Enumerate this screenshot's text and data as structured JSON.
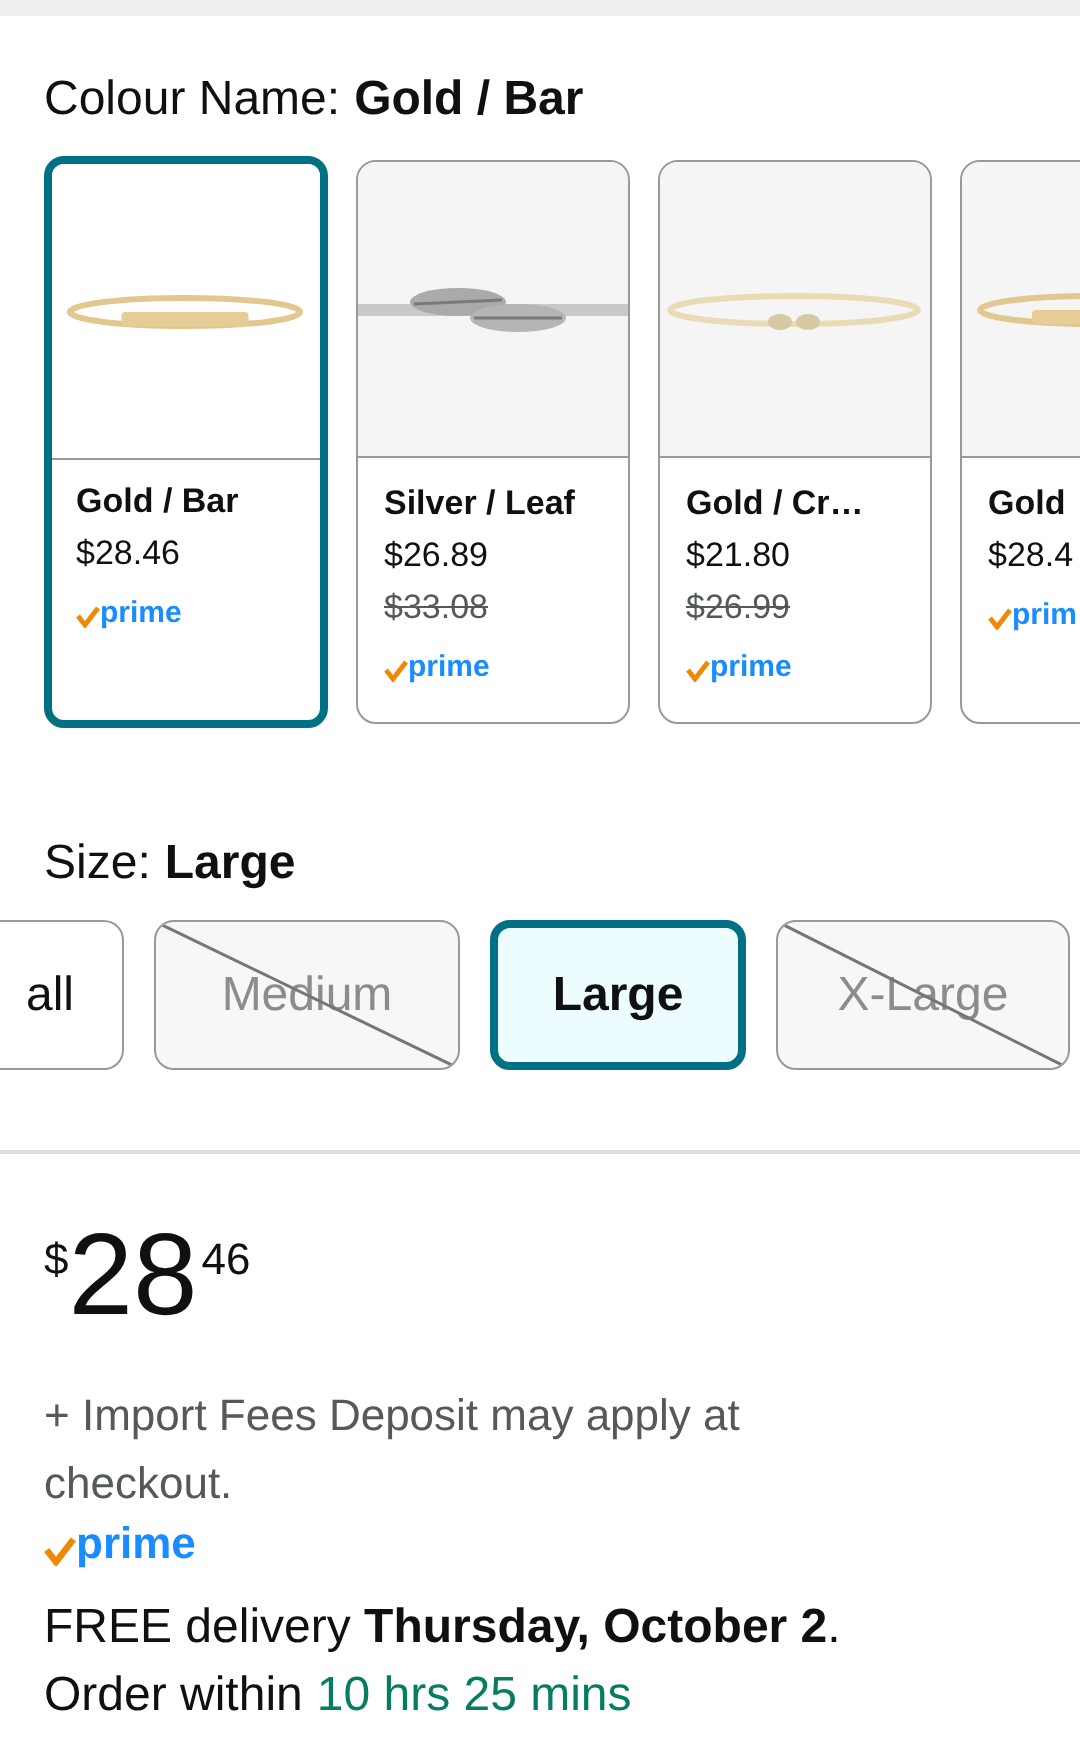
{
  "colour": {
    "label": "Colour Name:",
    "value": "Gold / Bar"
  },
  "swatches": [
    {
      "name": "Gold / Bar",
      "price": "$28.46",
      "badge": "prime",
      "selected": true
    },
    {
      "name": "Silver / Leaf",
      "price": "$26.89",
      "list_price": "$33.08",
      "badge": "prime",
      "selected": false
    },
    {
      "name": "Gold / Cr…",
      "price": "$21.80",
      "list_price": "$26.99",
      "badge": "prime",
      "selected": false
    },
    {
      "name": "Gold",
      "price": "$28.4",
      "badge": "prim",
      "selected": false
    }
  ],
  "size": {
    "label": "Size:",
    "value": "Large"
  },
  "sizes": [
    {
      "label": "all",
      "selected": false,
      "disabled": false
    },
    {
      "label": "Medium",
      "selected": false,
      "disabled": true
    },
    {
      "label": "Large",
      "selected": true,
      "disabled": false
    },
    {
      "label": "X-Large",
      "selected": false,
      "disabled": true
    }
  ],
  "price": {
    "symbol": "$",
    "whole": "28",
    "fraction": "46"
  },
  "import_note": "+ Import Fees Deposit may apply at checkout.",
  "badge": "prime",
  "delivery": "FREE delivery **Thursday, October 2**.",
  "order_within": {
    "label": "Order within",
    "countdown": "10 hrs 25 mins"
  }
}
